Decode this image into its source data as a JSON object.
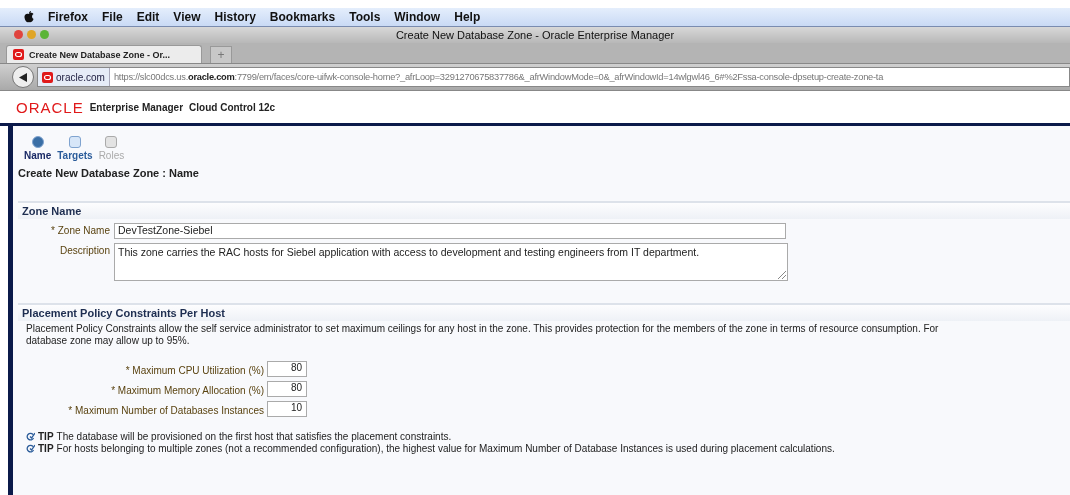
{
  "menu_bar": {
    "items": [
      "Firefox",
      "File",
      "Edit",
      "View",
      "History",
      "Bookmarks",
      "Tools",
      "Window",
      "Help"
    ]
  },
  "window": {
    "title": "Create New Database Zone - Oracle Enterprise Manager"
  },
  "tabs": [
    {
      "label": "Create New Database Zone - Or...",
      "selected": true
    }
  ],
  "new_tab": "+",
  "address_bar": {
    "site": "oracle.com",
    "url": "https://slc00dcs.us.**oracle.com**:7799/em/faces/core-uifwk-console-home?_afrLoop=3291270675837786&_afrWindowMode=0&_afrWindowId=14wlgwl46_6#%2Fssa-console-dpsetup-create-zone-ta"
  },
  "app_header": {
    "logo": "ORACLE",
    "product": "Enterprise Manager",
    "edition": "Cloud Control 12c"
  },
  "train": [
    {
      "label": "Name",
      "selected": true,
      "disabled": false
    },
    {
      "label": "Targets",
      "selected": false,
      "disabled": false
    },
    {
      "label": "Roles",
      "selected": false,
      "disabled": true
    }
  ],
  "page_title": "Create New Database Zone : Name",
  "zone_section": {
    "title": "Zone Name",
    "fields": [
      {
        "label": "* Zone Name",
        "kind": "text",
        "value": "DevTestZone-Siebel"
      },
      {
        "label": "Description",
        "kind": "textarea",
        "value": "This zone carries the RAC hosts for Siebel application with access to development and testing engineers from IT department."
      }
    ]
  },
  "placement_section": {
    "title": "Placement Policy Constraints Per Host",
    "description": [
      "Placement Policy Constraints allow the self service administrator to set maximum ceilings for any host in the zone. This provides protection for the members of the zone in terms of resource consumption. For",
      "database zone may allow up to 95%."
    ],
    "fields": [
      {
        "label": "* Maximum CPU Utilization (%)",
        "value": "80"
      },
      {
        "label": "* Maximum Memory Allocation (%)",
        "value": "80"
      },
      {
        "label": "* Maximum Number of Databases Instances",
        "value": "10"
      }
    ],
    "tips": [
      {
        "tag": "TIP",
        "text": "The database will be provisioned on the first host that satisfies the placement constraints."
      },
      {
        "tag": "TIP",
        "text": "For hosts belonging to multiple zones (not a recommended configuration), the highest value for Maximum Number of Database Instances is used during placement calculations."
      }
    ]
  }
}
